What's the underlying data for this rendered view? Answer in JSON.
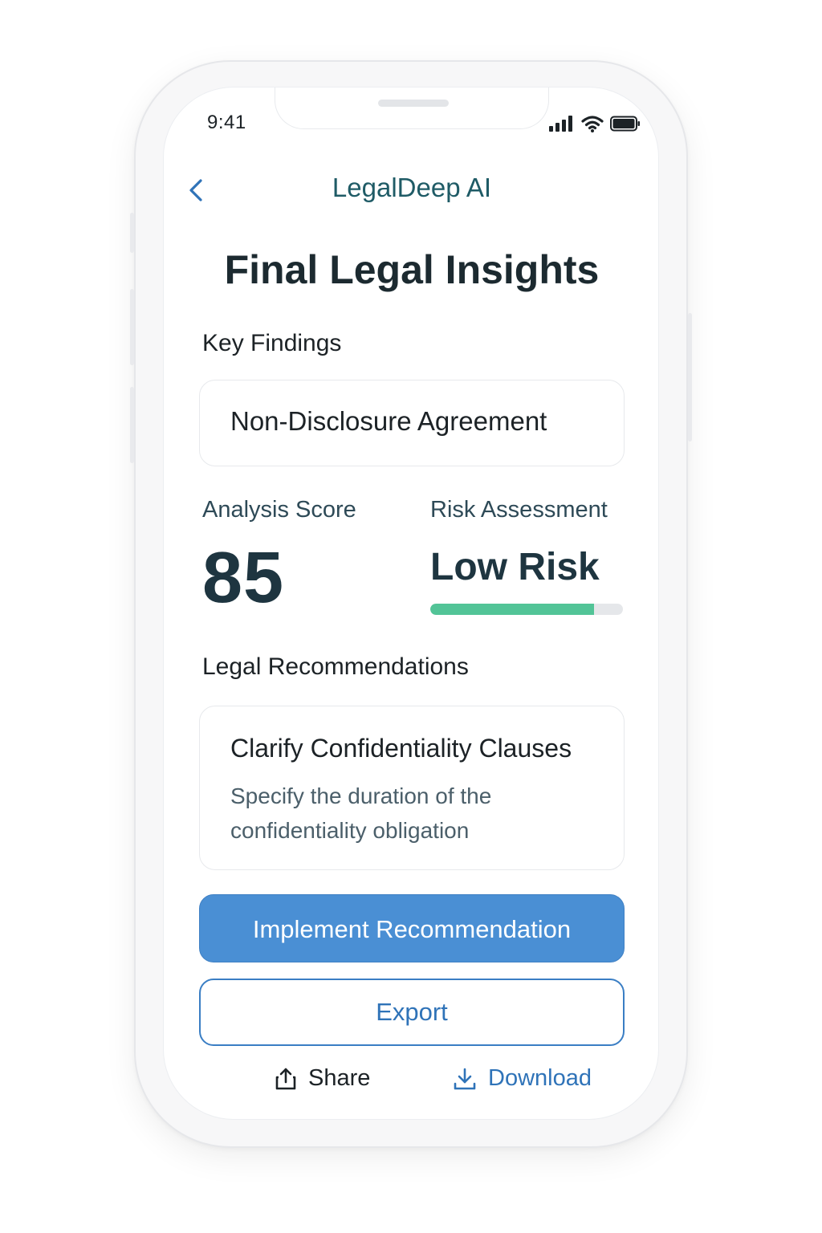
{
  "status_bar": {
    "time": "9:41",
    "icons": [
      "cellular-signal-icon",
      "wifi-icon",
      "battery-icon"
    ]
  },
  "nav": {
    "back_icon": "chevron-left-icon",
    "title": "LegalDeep AI"
  },
  "page": {
    "title": "Final Legal Insights"
  },
  "key_findings": {
    "heading": "Key Findings",
    "document": "Non-Disclosure Agreement"
  },
  "analysis": {
    "score_label": "Analysis Score",
    "score_value": "85",
    "risk_label": "Risk Assessment",
    "risk_value": "Low Risk",
    "risk_bar_fraction": 0.85,
    "risk_bar_color": "#52c497"
  },
  "recommendations": {
    "heading": "Legal Recommendations",
    "items": [
      {
        "title": "Clarify Confidentiality Clauses",
        "description": "Specify the duration of the confidentiality obligation"
      }
    ]
  },
  "actions": {
    "implement_label": "Implement Recommendation",
    "export_label": "Export",
    "share_label": "Share",
    "share_icon": "share-icon",
    "download_label": "Download",
    "download_icon": "download-icon"
  },
  "colors": {
    "accent": "#4a8fd4",
    "nav_title": "#1f5b66",
    "link": "#2f73b8"
  }
}
